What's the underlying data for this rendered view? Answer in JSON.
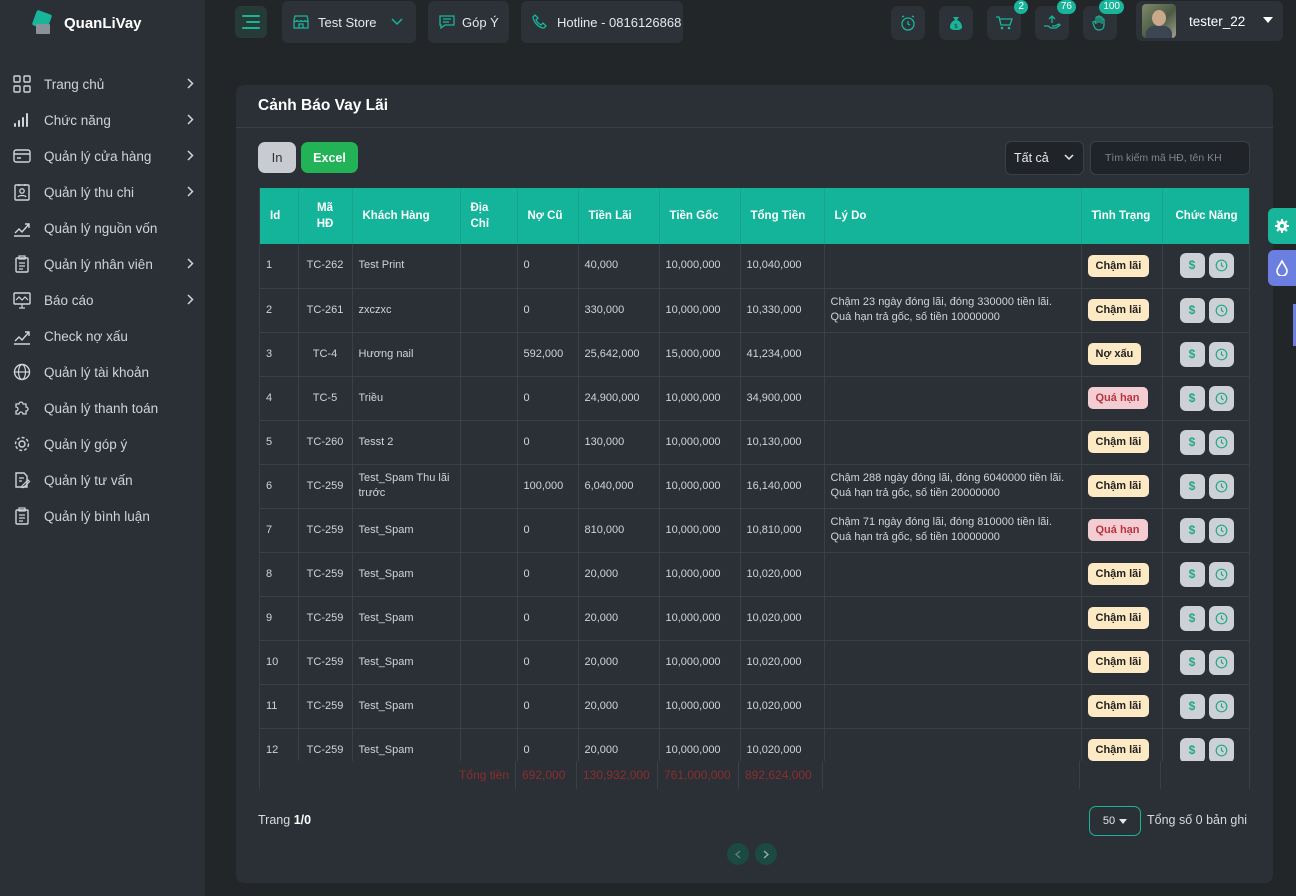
{
  "app": {
    "name": "QuanLiVay"
  },
  "sidebar": {
    "items": [
      {
        "label": "Trang chủ",
        "icon": "grid-icon",
        "has_arrow": true
      },
      {
        "label": "Chức năng",
        "icon": "bars-icon",
        "has_arrow": true
      },
      {
        "label": "Quản lý cửa hàng",
        "icon": "card-icon",
        "has_arrow": true
      },
      {
        "label": "Quản lý thu chi",
        "icon": "contact-icon",
        "has_arrow": true
      },
      {
        "label": "Quản lý nguồn vốn",
        "icon": "chart-up-icon",
        "has_arrow": false
      },
      {
        "label": "Quản lý nhân viên",
        "icon": "clipboard-icon",
        "has_arrow": true
      },
      {
        "label": "Báo cáo",
        "icon": "monitor-icon",
        "has_arrow": true
      },
      {
        "label": "Check nợ xấu",
        "icon": "chart-up-icon",
        "has_arrow": false
      },
      {
        "label": "Quản lý tài khoản",
        "icon": "globe-icon",
        "has_arrow": false
      },
      {
        "label": "Quản lý thanh toán",
        "icon": "puzzle-icon",
        "has_arrow": false
      },
      {
        "label": "Quản lý góp ý",
        "icon": "gear-icon",
        "has_arrow": false
      },
      {
        "label": "Quản lý tư vấn",
        "icon": "edit-icon",
        "has_arrow": false
      },
      {
        "label": "Quản lý bình luận",
        "icon": "clipboard-icon",
        "has_arrow": false
      }
    ]
  },
  "topbar": {
    "store": "Test Store",
    "feedback": "Góp Ý",
    "hotline": "Hotline - 0816126868",
    "badges": {
      "cart": "2",
      "money": "76",
      "hand": "100"
    },
    "username": "tester_22"
  },
  "card": {
    "title": "Cảnh Báo Vay Lãi",
    "btn_print": "In",
    "btn_excel": "Excel",
    "filter_selected": "Tất cả",
    "search_placeholder": "Tìm kiếm mã HĐ, tên KH"
  },
  "table": {
    "headers": [
      "Id",
      "Mã HĐ",
      "Khách Hàng",
      "Địa Chỉ",
      "Nợ Cũ",
      "Tiền Lãi",
      "Tiền Gốc",
      "Tổng Tiền",
      "Lý Do",
      "Tình Trạng",
      "Chức Năng"
    ],
    "rows": [
      {
        "id": "1",
        "code": "TC-262",
        "customer": "Test Print",
        "address": "",
        "old_debt": "0",
        "interest": "40,000",
        "principal": "10,000,000",
        "total": "10,040,000",
        "reason": "",
        "status": "Chậm lãi",
        "status_type": "cham"
      },
      {
        "id": "2",
        "code": "TC-261",
        "customer": "zxczxc",
        "address": "",
        "old_debt": "0",
        "interest": "330,000",
        "principal": "10,000,000",
        "total": "10,330,000",
        "reason": "Chậm 23 ngày đóng lãi, đóng 330000 tiền lãi. Quá hạn trả gốc, số tiền 10000000",
        "status": "Chậm lãi",
        "status_type": "cham"
      },
      {
        "id": "3",
        "code": "TC-4",
        "customer": "Hương nail",
        "address": "",
        "old_debt": "592,000",
        "interest": "25,642,000",
        "principal": "15,000,000",
        "total": "41,234,000",
        "reason": "",
        "status": "Nợ xấu",
        "status_type": "no"
      },
      {
        "id": "4",
        "code": "TC-5",
        "customer": "Triều",
        "address": "",
        "old_debt": "0",
        "interest": "24,900,000",
        "principal": "10,000,000",
        "total": "34,900,000",
        "reason": "",
        "status": "Quá hạn",
        "status_type": "qua"
      },
      {
        "id": "5",
        "code": "TC-260",
        "customer": "Tesst 2",
        "address": "",
        "old_debt": "0",
        "interest": "130,000",
        "principal": "10,000,000",
        "total": "10,130,000",
        "reason": "",
        "status": "Chậm lãi",
        "status_type": "cham"
      },
      {
        "id": "6",
        "code": "TC-259",
        "customer": "Test_Spam Thu lãi trước",
        "address": "",
        "old_debt": "100,000",
        "interest": "6,040,000",
        "principal": "10,000,000",
        "total": "16,140,000",
        "reason": "Chậm 288 ngày đóng lãi, đóng 6040000 tiền lãi. Quá hạn trả gốc, số tiền 20000000",
        "status": "Chậm lãi",
        "status_type": "cham"
      },
      {
        "id": "7",
        "code": "TC-259",
        "customer": "Test_Spam",
        "address": "",
        "old_debt": "0",
        "interest": "810,000",
        "principal": "10,000,000",
        "total": "10,810,000",
        "reason": "Chậm 71 ngày đóng lãi, đóng 810000 tiền lãi. Quá hạn trả gốc, số tiền 10000000",
        "status": "Quá hạn",
        "status_type": "qua"
      },
      {
        "id": "8",
        "code": "TC-259",
        "customer": "Test_Spam",
        "address": "",
        "old_debt": "0",
        "interest": "20,000",
        "principal": "10,000,000",
        "total": "10,020,000",
        "reason": "",
        "status": "Chậm lãi",
        "status_type": "cham"
      },
      {
        "id": "9",
        "code": "TC-259",
        "customer": "Test_Spam",
        "address": "",
        "old_debt": "0",
        "interest": "20,000",
        "principal": "10,000,000",
        "total": "10,020,000",
        "reason": "",
        "status": "Chậm lãi",
        "status_type": "cham"
      },
      {
        "id": "10",
        "code": "TC-259",
        "customer": "Test_Spam",
        "address": "",
        "old_debt": "0",
        "interest": "20,000",
        "principal": "10,000,000",
        "total": "10,020,000",
        "reason": "",
        "status": "Chậm lãi",
        "status_type": "cham"
      },
      {
        "id": "11",
        "code": "TC-259",
        "customer": "Test_Spam",
        "address": "",
        "old_debt": "0",
        "interest": "20,000",
        "principal": "10,000,000",
        "total": "10,020,000",
        "reason": "",
        "status": "Chậm lãi",
        "status_type": "cham"
      },
      {
        "id": "12",
        "code": "TC-259",
        "customer": "Test_Spam",
        "address": "",
        "old_debt": "0",
        "interest": "20,000",
        "principal": "10,000,000",
        "total": "10,020,000",
        "reason": "",
        "status": "Chậm lãi",
        "status_type": "cham"
      }
    ],
    "totals": {
      "label": "Tổng tiền",
      "old_debt": "692,000",
      "interest": "130,932,000",
      "principal": "761,000,000",
      "total": "892,624,000"
    }
  },
  "footer": {
    "page_prefix": "Trang",
    "page_value": "1/0",
    "page_size": "50",
    "total_records": "Tổng số 0 bản ghi"
  },
  "colors": {
    "accent": "#13b49a",
    "excel": "#21b356",
    "danger": "#b83440"
  }
}
